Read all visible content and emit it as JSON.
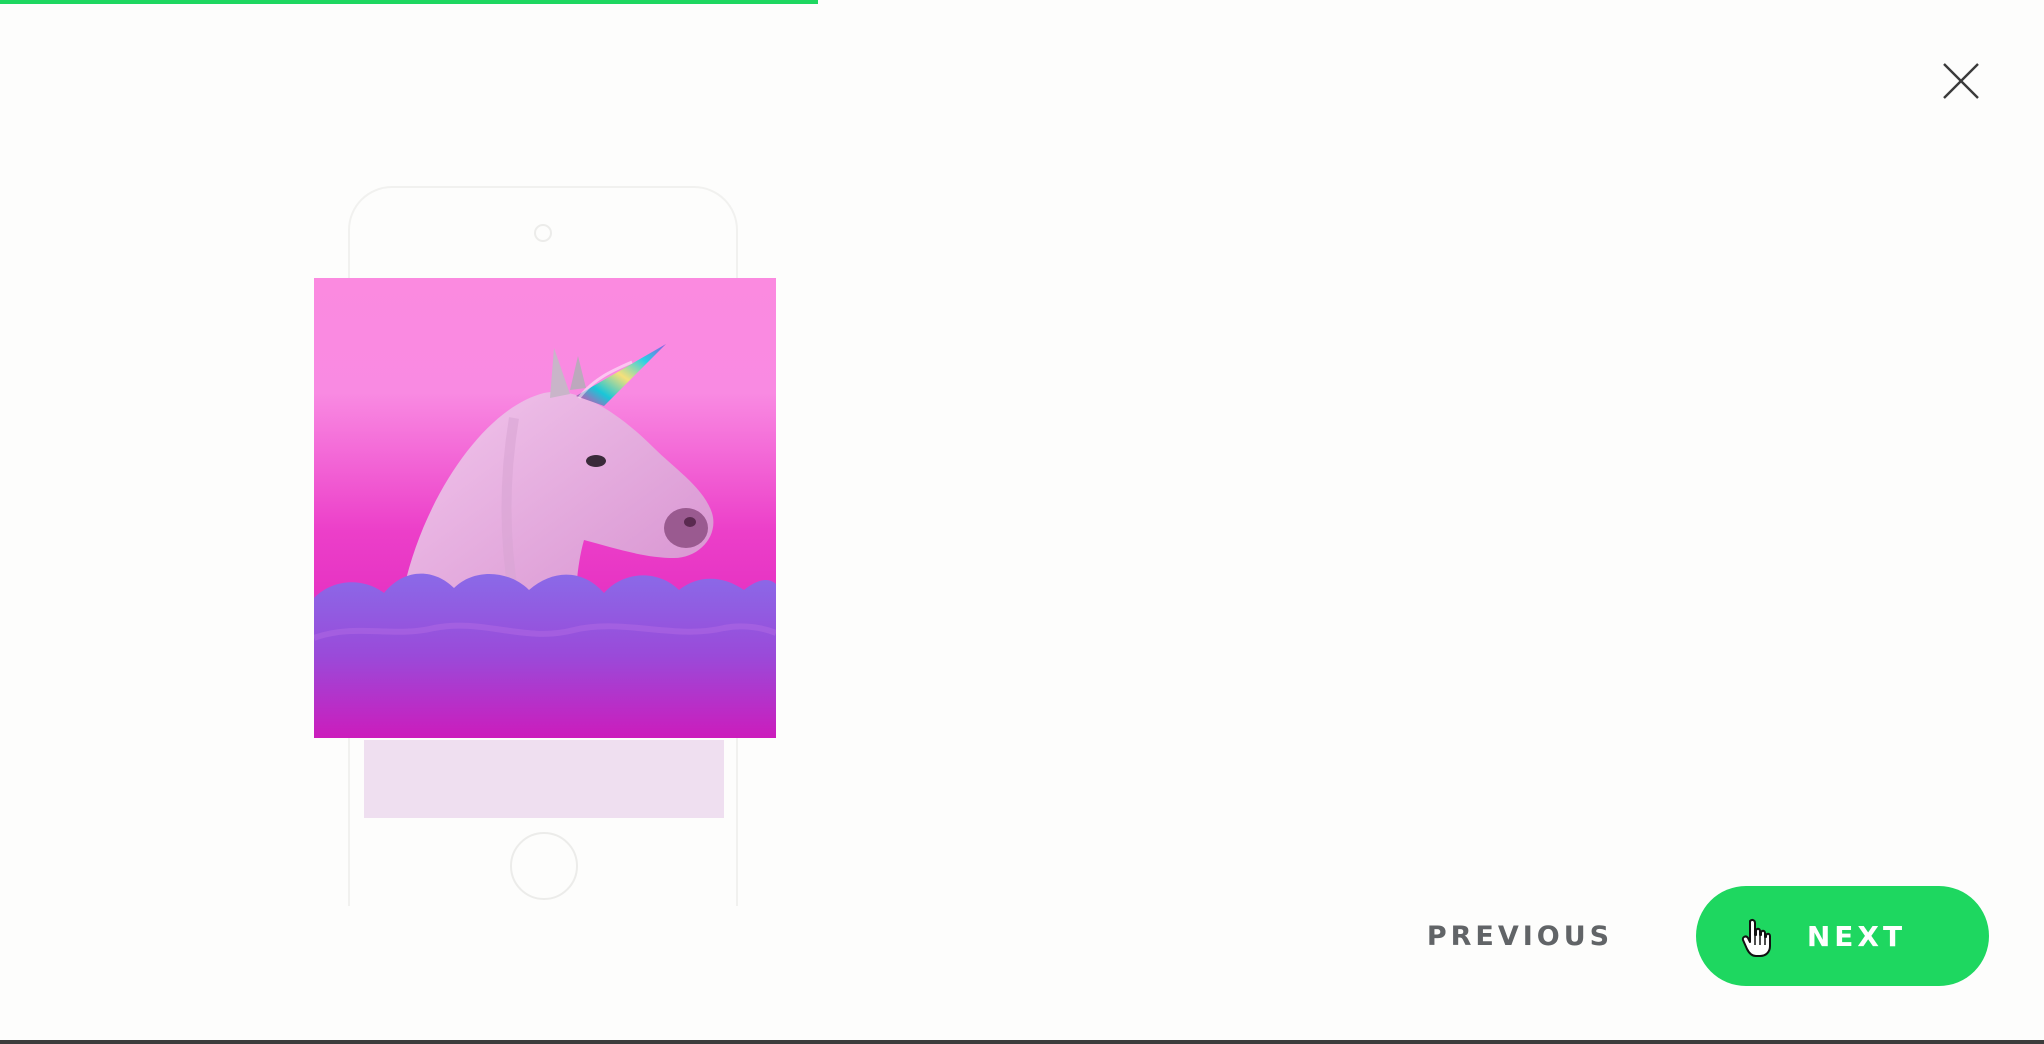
{
  "progress": {
    "fraction": 0.4
  },
  "colors": {
    "accent": "#1ed760",
    "previous_text": "#616467",
    "background": "#fdfdfc"
  },
  "icons": {
    "close": "close-icon",
    "cursor": "hand-pointer-icon"
  },
  "artwork": {
    "description_icon": "unicorn-image"
  },
  "nav": {
    "previous_label": "PREVIOUS",
    "next_label": "NEXT"
  }
}
